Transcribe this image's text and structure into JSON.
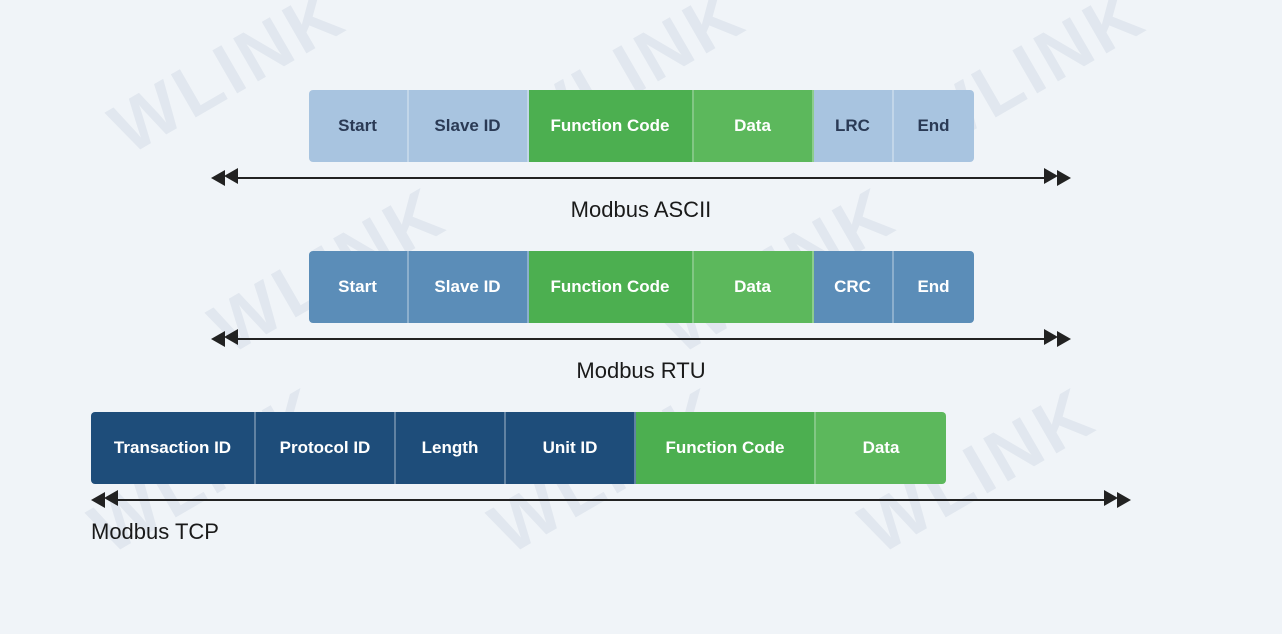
{
  "watermark": {
    "texts": [
      "WLINK",
      "WLINK",
      "WLINK",
      "WLINK",
      "WLINK",
      "WLINK"
    ]
  },
  "protocols": {
    "ascii": {
      "label": "Modbus ASCII",
      "cells": [
        {
          "id": "start",
          "text": "Start",
          "color": "light-blue"
        },
        {
          "id": "slave-id",
          "text": "Slave ID",
          "color": "light-blue"
        },
        {
          "id": "function-code",
          "text": "Function Code",
          "color": "green"
        },
        {
          "id": "data",
          "text": "Data",
          "color": "bright-green"
        },
        {
          "id": "lrc",
          "text": "LRC",
          "color": "light-blue"
        },
        {
          "id": "end",
          "text": "End",
          "color": "light-blue"
        }
      ]
    },
    "rtu": {
      "label": "Modbus RTU",
      "cells": [
        {
          "id": "start",
          "text": "Start",
          "color": "medium-blue"
        },
        {
          "id": "slave-id",
          "text": "Slave ID",
          "color": "medium-blue"
        },
        {
          "id": "function-code",
          "text": "Function Code",
          "color": "green"
        },
        {
          "id": "data",
          "text": "Data",
          "color": "bright-green"
        },
        {
          "id": "crc",
          "text": "CRC",
          "color": "medium-blue"
        },
        {
          "id": "end",
          "text": "End",
          "color": "medium-blue"
        }
      ]
    },
    "tcp": {
      "label": "Modbus TCP",
      "cells": [
        {
          "id": "transaction-id",
          "text": "Transaction ID",
          "color": "dark-blue"
        },
        {
          "id": "protocol-id",
          "text": "Protocol ID",
          "color": "dark-blue"
        },
        {
          "id": "length",
          "text": "Length",
          "color": "dark-blue"
        },
        {
          "id": "unit-id",
          "text": "Unit ID",
          "color": "dark-blue"
        },
        {
          "id": "function-code",
          "text": "Function Code",
          "color": "green"
        },
        {
          "id": "data",
          "text": "Data",
          "color": "bright-green"
        }
      ]
    }
  }
}
